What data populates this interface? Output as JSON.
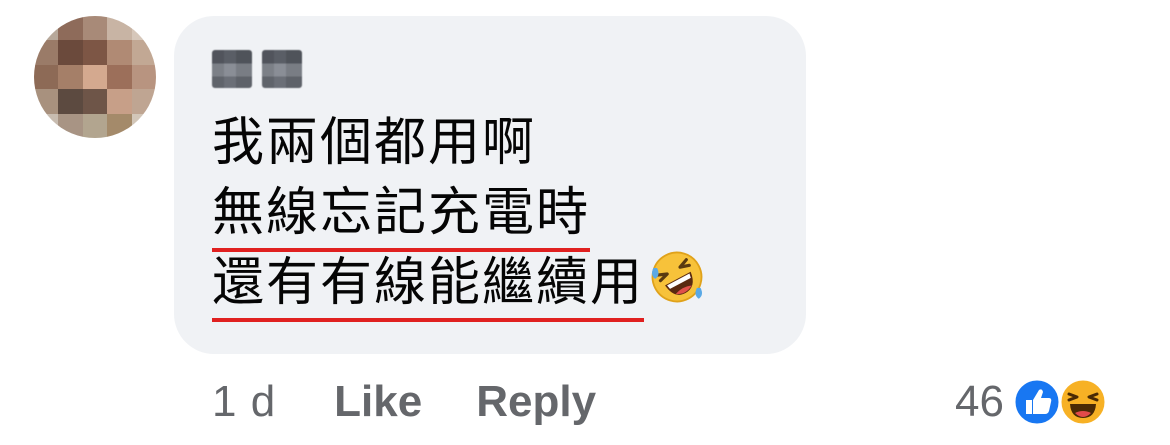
{
  "comment": {
    "lines": [
      "我兩個都用啊",
      "無線忘記充電時",
      "還有有線能繼續用"
    ],
    "emoji": "rolling-on-floor-laughing",
    "underline_color": "#e02020"
  },
  "actions": {
    "timestamp": "1 d",
    "like_label": "Like",
    "reply_label": "Reply"
  },
  "reactions": {
    "count": "46",
    "types": [
      "like-reaction-icon",
      "haha-reaction-icon"
    ]
  },
  "colors": {
    "bubble": "#f0f2f5",
    "text": "#050505",
    "meta": "#65676b",
    "like_blue": "#1877f2",
    "haha_yellow": "#f7b125"
  }
}
